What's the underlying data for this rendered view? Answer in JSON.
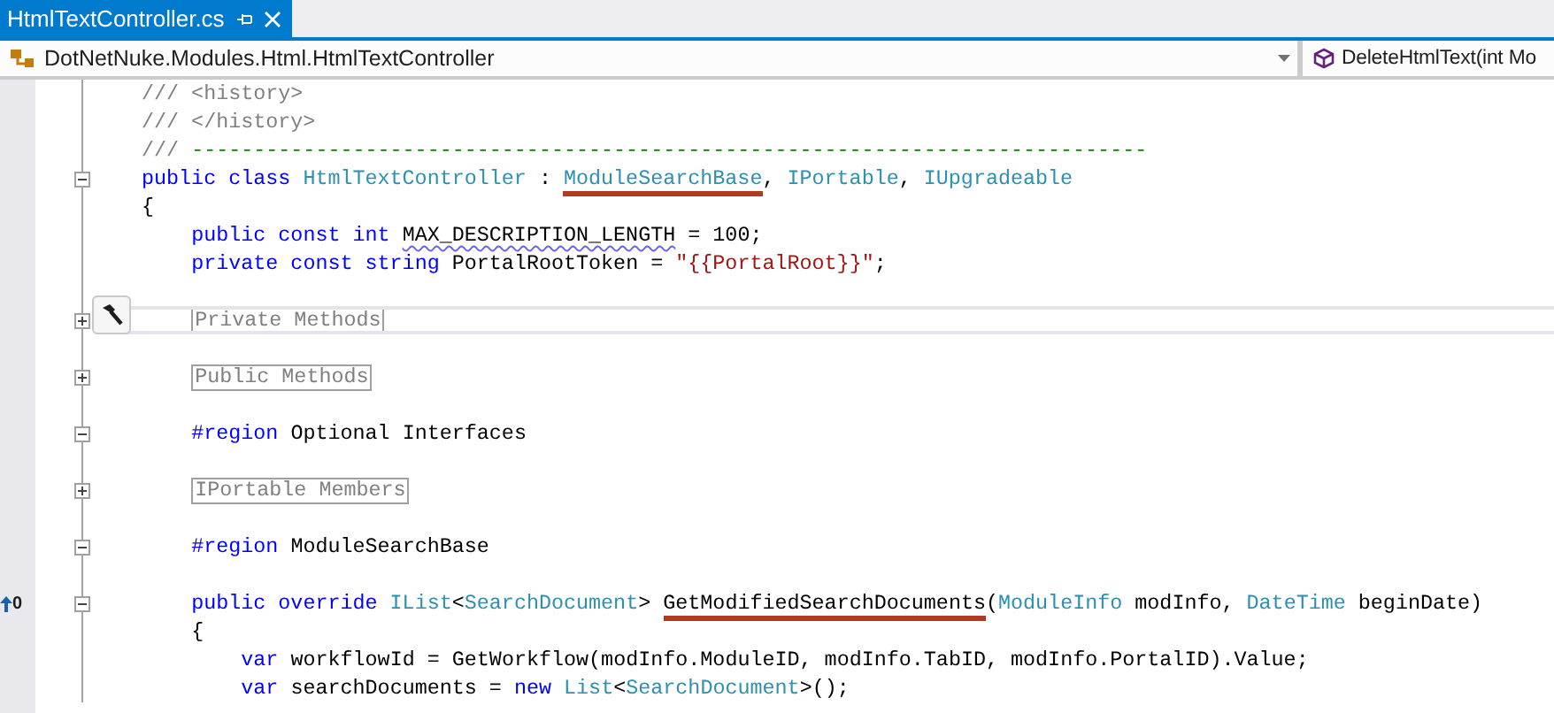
{
  "tab": {
    "title": "HtmlTextController.cs",
    "selected": true
  },
  "navbar": {
    "type_scope": "DotNetNuke.Modules.Html.HtmlTextController",
    "member": "DeleteHtmlText(int Mo"
  },
  "editor": {
    "lines": [
      {
        "kind": "code",
        "tokens": [
          {
            "kind": "doc",
            "text": "/// <history>"
          }
        ]
      },
      {
        "kind": "code",
        "tokens": [
          {
            "kind": "doc",
            "text": "/// </history>"
          }
        ]
      },
      {
        "kind": "code",
        "tokens": [
          {
            "kind": "doc",
            "text": "/// "
          },
          {
            "kind": "comment",
            "text": "-----------------------------------------------------------------------------"
          }
        ]
      },
      {
        "kind": "code",
        "expanded": true,
        "tokens": [
          {
            "kind": "keyword",
            "text": "public class "
          },
          {
            "kind": "type",
            "text": "HtmlTextController"
          },
          {
            "kind": "plain",
            "text": " : "
          },
          {
            "kind": "type",
            "text": "ModuleSearchBase",
            "underline": true
          },
          {
            "kind": "plain",
            "text": ", "
          },
          {
            "kind": "type",
            "text": "IPortable"
          },
          {
            "kind": "plain",
            "text": ", "
          },
          {
            "kind": "type",
            "text": "IUpgradeable"
          }
        ]
      },
      {
        "kind": "code",
        "tokens": [
          {
            "kind": "plain",
            "text": "{"
          }
        ],
        "children": [
          {
            "kind": "code",
            "tokens": [
              {
                "kind": "keyword",
                "text": "public const int "
              },
              {
                "kind": "plain",
                "text": "MAX_DESCRIPTION_LENGTH",
                "squiggle": true
              },
              {
                "kind": "plain",
                "text": " = 100;"
              }
            ]
          },
          {
            "kind": "code",
            "tokens": [
              {
                "kind": "keyword",
                "text": "private const string "
              },
              {
                "kind": "plain",
                "text": "PortalRootToken = "
              },
              {
                "kind": "string",
                "text": "\"{{PortalRoot}}\""
              },
              {
                "kind": "plain",
                "text": ";"
              }
            ]
          },
          {
            "kind": "blank"
          },
          {
            "kind": "code",
            "expanded": false,
            "current": true,
            "tokens": [
              {
                "kind": "collapsed",
                "text": "Private Methods"
              }
            ]
          },
          {
            "kind": "blank"
          },
          {
            "kind": "code",
            "expanded": false,
            "tokens": [
              {
                "kind": "collapsed",
                "text": "Public Methods"
              }
            ]
          },
          {
            "kind": "blank"
          },
          {
            "kind": "code",
            "expanded": true,
            "tokens": [
              {
                "kind": "keyword",
                "text": "#region"
              },
              {
                "kind": "plain",
                "text": " Optional Interfaces"
              }
            ]
          },
          {
            "kind": "blank"
          },
          {
            "kind": "code",
            "expanded": false,
            "tokens": [
              {
                "kind": "collapsed",
                "text": "IPortable Members"
              }
            ]
          },
          {
            "kind": "blank"
          },
          {
            "kind": "code",
            "expanded": true,
            "tokens": [
              {
                "kind": "keyword",
                "text": "#region"
              },
              {
                "kind": "plain",
                "text": " ModuleSearchBase"
              }
            ]
          },
          {
            "kind": "blank"
          },
          {
            "kind": "code",
            "expanded": true,
            "marker": "0",
            "tokens": [
              {
                "kind": "keyword",
                "text": "public override "
              },
              {
                "kind": "type",
                "text": "IList"
              },
              {
                "kind": "plain",
                "text": "<"
              },
              {
                "kind": "type",
                "text": "SearchDocument"
              },
              {
                "kind": "plain",
                "text": "> "
              },
              {
                "kind": "plain",
                "text": "GetModifiedSearchDocuments",
                "underline": true
              },
              {
                "kind": "plain",
                "text": "("
              },
              {
                "kind": "type",
                "text": "ModuleInfo"
              },
              {
                "kind": "plain",
                "text": " modInfo, "
              },
              {
                "kind": "type",
                "text": "DateTime"
              },
              {
                "kind": "plain",
                "text": " beginDate)"
              }
            ]
          },
          {
            "kind": "code",
            "tokens": [
              {
                "kind": "plain",
                "text": "{"
              }
            ],
            "children": [
              {
                "kind": "code",
                "tokens": [
                  {
                    "kind": "keyword",
                    "text": "var"
                  },
                  {
                    "kind": "plain",
                    "text": " workflowId = GetWorkflow(modInfo.ModuleID, modInfo.TabID, modInfo.PortalID).Value;"
                  }
                ]
              },
              {
                "kind": "code",
                "tokens": [
                  {
                    "kind": "keyword",
                    "text": "var"
                  },
                  {
                    "kind": "plain",
                    "text": " searchDocuments = "
                  },
                  {
                    "kind": "keyword",
                    "text": "new "
                  },
                  {
                    "kind": "type",
                    "text": "List"
                  },
                  {
                    "kind": "plain",
                    "text": "<"
                  },
                  {
                    "kind": "type",
                    "text": "SearchDocument"
                  },
                  {
                    "kind": "plain",
                    "text": ">();"
                  }
                ]
              }
            ]
          }
        ]
      }
    ]
  }
}
